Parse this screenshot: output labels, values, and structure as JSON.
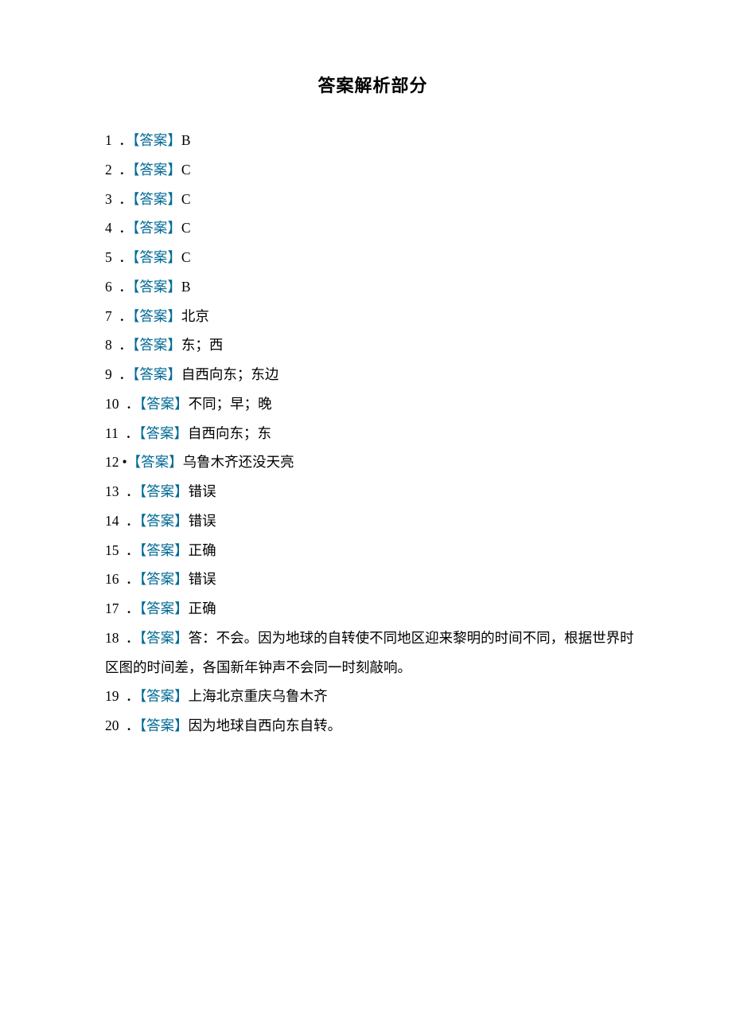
{
  "title": "答案解析部分",
  "label_text": "【答案】",
  "dot_text": "．",
  "bullet_sep": "•",
  "items": [
    {
      "num": "1",
      "sep_style": "spaced",
      "answer": "B"
    },
    {
      "num": "2",
      "sep_style": "spaced",
      "answer": "C"
    },
    {
      "num": "3",
      "sep_style": "spaced",
      "answer": "C"
    },
    {
      "num": "4",
      "sep_style": "spaced",
      "answer": "C"
    },
    {
      "num": "5",
      "sep_style": "spaced",
      "answer": "C"
    },
    {
      "num": "6",
      "sep_style": "spaced",
      "answer": "B"
    },
    {
      "num": "7",
      "sep_style": "spaced",
      "answer": "北京"
    },
    {
      "num": "8",
      "sep_style": "spaced",
      "answer": "东；西"
    },
    {
      "num": "9",
      "sep_style": "spaced",
      "answer": "自西向东；东边"
    },
    {
      "num": "10",
      "sep_style": "spaced",
      "answer": "不同；早；晚"
    },
    {
      "num": "11",
      "sep_style": "spaced",
      "answer": "自西向东；东"
    },
    {
      "num": "12",
      "sep_style": "bullet",
      "answer": "乌鲁木齐还没天亮"
    },
    {
      "num": "13",
      "sep_style": "spaced",
      "answer": "错误"
    },
    {
      "num": "14",
      "sep_style": "spaced",
      "answer": "错误"
    },
    {
      "num": "15",
      "sep_style": "spaced",
      "answer": "正确"
    },
    {
      "num": "16",
      "sep_style": "spaced",
      "answer": "错误"
    },
    {
      "num": "17",
      "sep_style": "spaced",
      "answer": "正确"
    },
    {
      "num": "18",
      "sep_style": "spaced",
      "answer": "答：不会。因为地球的自转使不同地区迎来黎明的时间不同，根据世界时区图的时间差，各国新年钟声不会同一时刻敲响。"
    },
    {
      "num": "19",
      "sep_style": "spaced",
      "answer": "上海北京重庆乌鲁木齐"
    },
    {
      "num": "20",
      "sep_style": "spaced",
      "answer": "因为地球自西向东自转。"
    }
  ]
}
